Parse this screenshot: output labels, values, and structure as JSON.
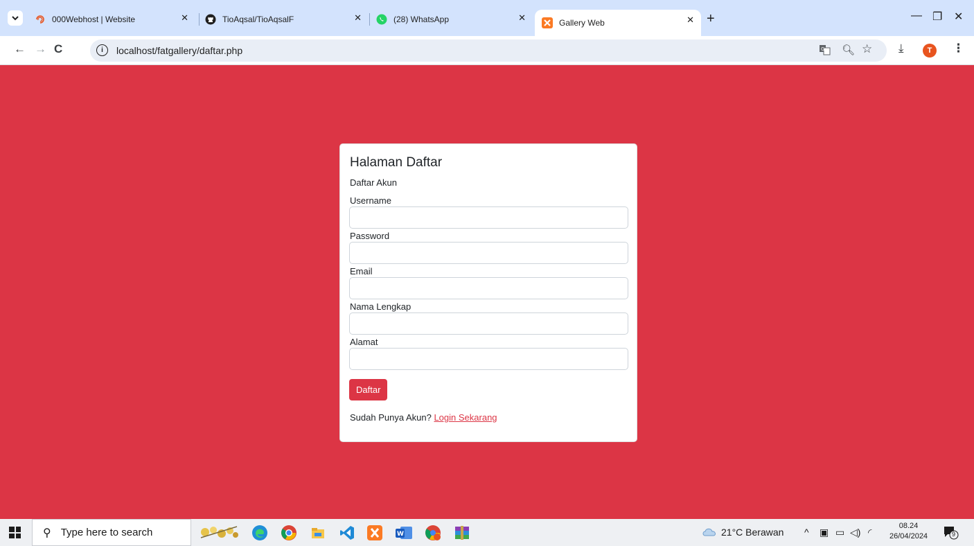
{
  "browser": {
    "tabs": [
      {
        "title": "000Webhost | Website",
        "favicon": "000webhost-icon"
      },
      {
        "title": "TioAqsal/TioAqsalF",
        "favicon": "github-icon"
      },
      {
        "title": "(28) WhatsApp",
        "favicon": "whatsapp-icon"
      },
      {
        "title": "Gallery Web",
        "favicon": "xampp-icon",
        "active": true
      }
    ],
    "url": "localhost/fatgallery/daftar.php",
    "profile_initial": "T"
  },
  "page": {
    "background": "#dc3545",
    "title": "Halaman Daftar",
    "subtitle": "Daftar Akun",
    "fields": [
      {
        "label": "Username",
        "value": ""
      },
      {
        "label": "Password",
        "value": ""
      },
      {
        "label": "Email",
        "value": ""
      },
      {
        "label": "Nama Lengkap",
        "value": ""
      },
      {
        "label": "Alamat",
        "value": ""
      }
    ],
    "submit_label": "Daftar",
    "footer_text": "Sudah Punya Akun?",
    "footer_link": "Login Sekarang"
  },
  "taskbar": {
    "search_placeholder": "Type here to search",
    "weather": "21°C  Berawan",
    "time": "08.24",
    "date": "26/04/2024",
    "notification_count": "9"
  }
}
